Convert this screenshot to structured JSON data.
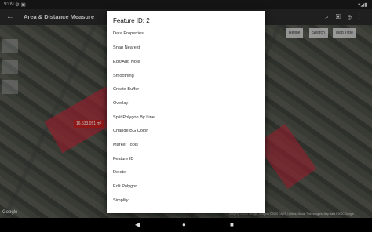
{
  "status": {
    "time": "9:09",
    "right": "▾◢▮"
  },
  "app": {
    "title": "Area & Distance Measure"
  },
  "map": {
    "area_label": "16,533.051 m²",
    "google": "Google",
    "credits": "Imagery ©2020 Google, Imagery ©2020 CNES / Airbus, Maxar Technologies, Map data ©2020 Google",
    "buttons": [
      "Refine",
      "Search",
      "Map Type"
    ]
  },
  "dialog": {
    "title": "Feature ID: 2",
    "items": [
      "Data Properties",
      "Snap Nearest",
      "Edit/Add Note",
      "Smoothing",
      "Create Buffer",
      "Overlay",
      "Split Polygon By Line",
      "Change BG Color",
      "Marker Tools",
      "Feature ID",
      "Delete",
      "Edit Polygon",
      "Simplify"
    ]
  },
  "icons": [
    "back-arrow-icon",
    "search-icon",
    "layers-icon",
    "zoom-icon",
    "more-icon",
    "back-nav-icon",
    "home-nav-icon",
    "recents-nav-icon"
  ]
}
